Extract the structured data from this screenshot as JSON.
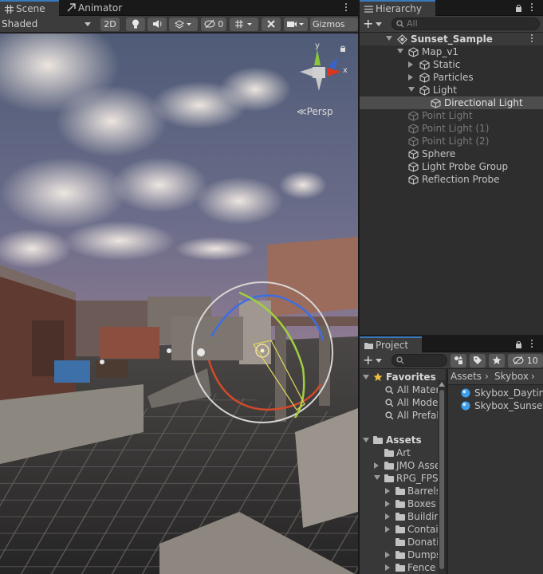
{
  "scene_window": {
    "tabs": [
      {
        "label": "Scene",
        "icon": "grid-icon",
        "active": true
      },
      {
        "label": "Animator",
        "icon": "animator-icon",
        "active": false
      }
    ],
    "toolbar": {
      "draw_mode": "Shaded",
      "mode_2d": "2D",
      "hidden_count": "0",
      "gizmos_label": "Gizmos"
    },
    "view_gizmo": {
      "projection_label": "Persp",
      "axis_x": "x",
      "axis_y": "y"
    }
  },
  "hierarchy": {
    "tab_label": "Hierarchy",
    "search_placeholder": "All",
    "scene_name": "Sunset_Sample",
    "items": [
      {
        "label": "Map_v1",
        "depth": 1,
        "expand": "open",
        "dim": false,
        "selected": false
      },
      {
        "label": "Static",
        "depth": 2,
        "expand": "closed",
        "dim": false,
        "selected": false
      },
      {
        "label": "Particles",
        "depth": 2,
        "expand": "closed",
        "dim": false,
        "selected": false
      },
      {
        "label": "Light",
        "depth": 2,
        "expand": "open",
        "dim": false,
        "selected": false
      },
      {
        "label": "Directional Light",
        "depth": 3,
        "expand": "none",
        "dim": false,
        "selected": true
      },
      {
        "label": "Point Light",
        "depth": 1,
        "expand": "none",
        "dim": true,
        "selected": false
      },
      {
        "label": "Point Light (1)",
        "depth": 1,
        "expand": "none",
        "dim": true,
        "selected": false
      },
      {
        "label": "Point Light (2)",
        "depth": 1,
        "expand": "none",
        "dim": true,
        "selected": false
      },
      {
        "label": "Sphere",
        "depth": 1,
        "expand": "none",
        "dim": false,
        "selected": false
      },
      {
        "label": "Light Probe Group",
        "depth": 1,
        "expand": "none",
        "dim": false,
        "selected": false
      },
      {
        "label": "Reflection Probe",
        "depth": 1,
        "expand": "none",
        "dim": false,
        "selected": false
      }
    ]
  },
  "project": {
    "tab_label": "Project",
    "hidden_count": "10",
    "breadcrumb": [
      "Assets",
      "Skybox"
    ],
    "favorites_label": "Favorites",
    "favorites": [
      "All Materials",
      "All Models",
      "All Prefabs"
    ],
    "assets_label": "Assets",
    "tree": [
      {
        "label": "Art",
        "depth": 1,
        "expand": "none"
      },
      {
        "label": "JMO Assets",
        "depth": 1,
        "expand": "closed"
      },
      {
        "label": "RPG_FPS",
        "depth": 1,
        "expand": "open"
      },
      {
        "label": "Barrels",
        "depth": 2,
        "expand": "closed"
      },
      {
        "label": "Boxes",
        "depth": 2,
        "expand": "closed"
      },
      {
        "label": "Buildings",
        "depth": 2,
        "expand": "closed"
      },
      {
        "label": "Containers",
        "depth": 2,
        "expand": "closed"
      },
      {
        "label": "Donations",
        "depth": 2,
        "expand": "none"
      },
      {
        "label": "Dumpster",
        "depth": 2,
        "expand": "closed"
      },
      {
        "label": "Fence",
        "depth": 2,
        "expand": "closed"
      }
    ],
    "files": [
      "Skybox_Daytime",
      "Skybox_Sunset"
    ]
  }
}
